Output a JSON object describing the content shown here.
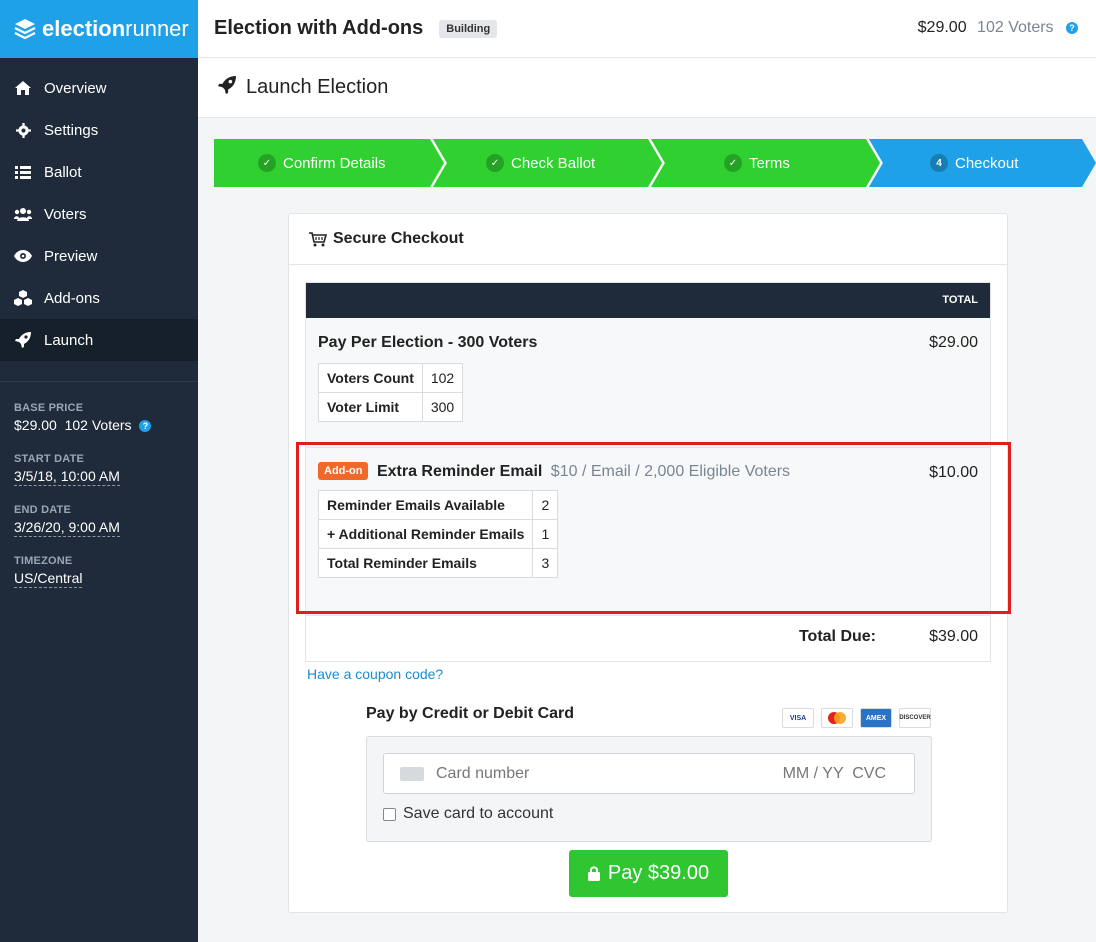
{
  "brand": {
    "name_bold": "election",
    "name_light": "runner"
  },
  "sidebar": {
    "items": [
      {
        "label": "Overview",
        "icon": "home-icon"
      },
      {
        "label": "Settings",
        "icon": "gear-icon"
      },
      {
        "label": "Ballot",
        "icon": "list-icon"
      },
      {
        "label": "Voters",
        "icon": "users-icon"
      },
      {
        "label": "Preview",
        "icon": "eye-icon"
      },
      {
        "label": "Add-ons",
        "icon": "cubes-icon"
      },
      {
        "label": "Launch",
        "icon": "rocket-icon",
        "active": true
      }
    ],
    "meta": {
      "base_price_label": "BASE PRICE",
      "base_price_value": "$29.00",
      "base_price_voters": "102 Voters",
      "start_label": "START DATE",
      "start_value": "3/5/18, 10:00 AM",
      "end_label": "END DATE",
      "end_value": "3/26/20, 9:00 AM",
      "tz_label": "TIMEZONE",
      "tz_value": "US/Central"
    }
  },
  "header": {
    "title": "Election with Add-ons",
    "badge": "Building",
    "price": "$29.00",
    "voters": "102 Voters"
  },
  "subheader": {
    "title": "Launch Election"
  },
  "steps": [
    {
      "label": "Confirm Details",
      "marker": "✓",
      "state": "done"
    },
    {
      "label": "Check Ballot",
      "marker": "✓",
      "state": "done"
    },
    {
      "label": "Terms",
      "marker": "✓",
      "state": "done"
    },
    {
      "label": "Checkout",
      "marker": "4",
      "state": "active"
    }
  ],
  "checkout": {
    "title": "Secure Checkout",
    "table_header": "TOTAL",
    "plan": {
      "name": "Pay Per Election - 300 Voters",
      "price": "$29.00",
      "rows": [
        {
          "k": "Voters Count",
          "v": "102"
        },
        {
          "k": "Voter Limit",
          "v": "300"
        }
      ]
    },
    "addon": {
      "tag": "Add-on",
      "name": "Extra Reminder Email",
      "desc": "$10 / Email / 2,000 Eligible Voters",
      "price": "$10.00",
      "rows": [
        {
          "k": "Reminder Emails Available",
          "v": "2"
        },
        {
          "k": "+ Additional Reminder Emails",
          "v": "1"
        },
        {
          "k": "Total Reminder Emails",
          "v": "3"
        }
      ]
    },
    "total_label": "Total Due:",
    "total_value": "$39.00",
    "coupon": "Have a coupon code?",
    "pay_title": "Pay by Credit or Debit Card",
    "card_brands": [
      "VISA",
      "MasterCard",
      "AMEX",
      "DISCOVER"
    ],
    "card_placeholder": "Card number",
    "card_right_placeholder": "MM / YY  CVC",
    "save_card": "Save card to account",
    "pay_button": "Pay $39.00"
  },
  "colors": {
    "sidebar_bg": "#1f2b3a",
    "brand_blue": "#1ea1e6",
    "step_green": "#2fd02f",
    "step_blue": "#1ea1e6",
    "addon_orange": "#f0692a",
    "pay_green": "#2fc631",
    "highlight_red": "#e01e1e"
  }
}
